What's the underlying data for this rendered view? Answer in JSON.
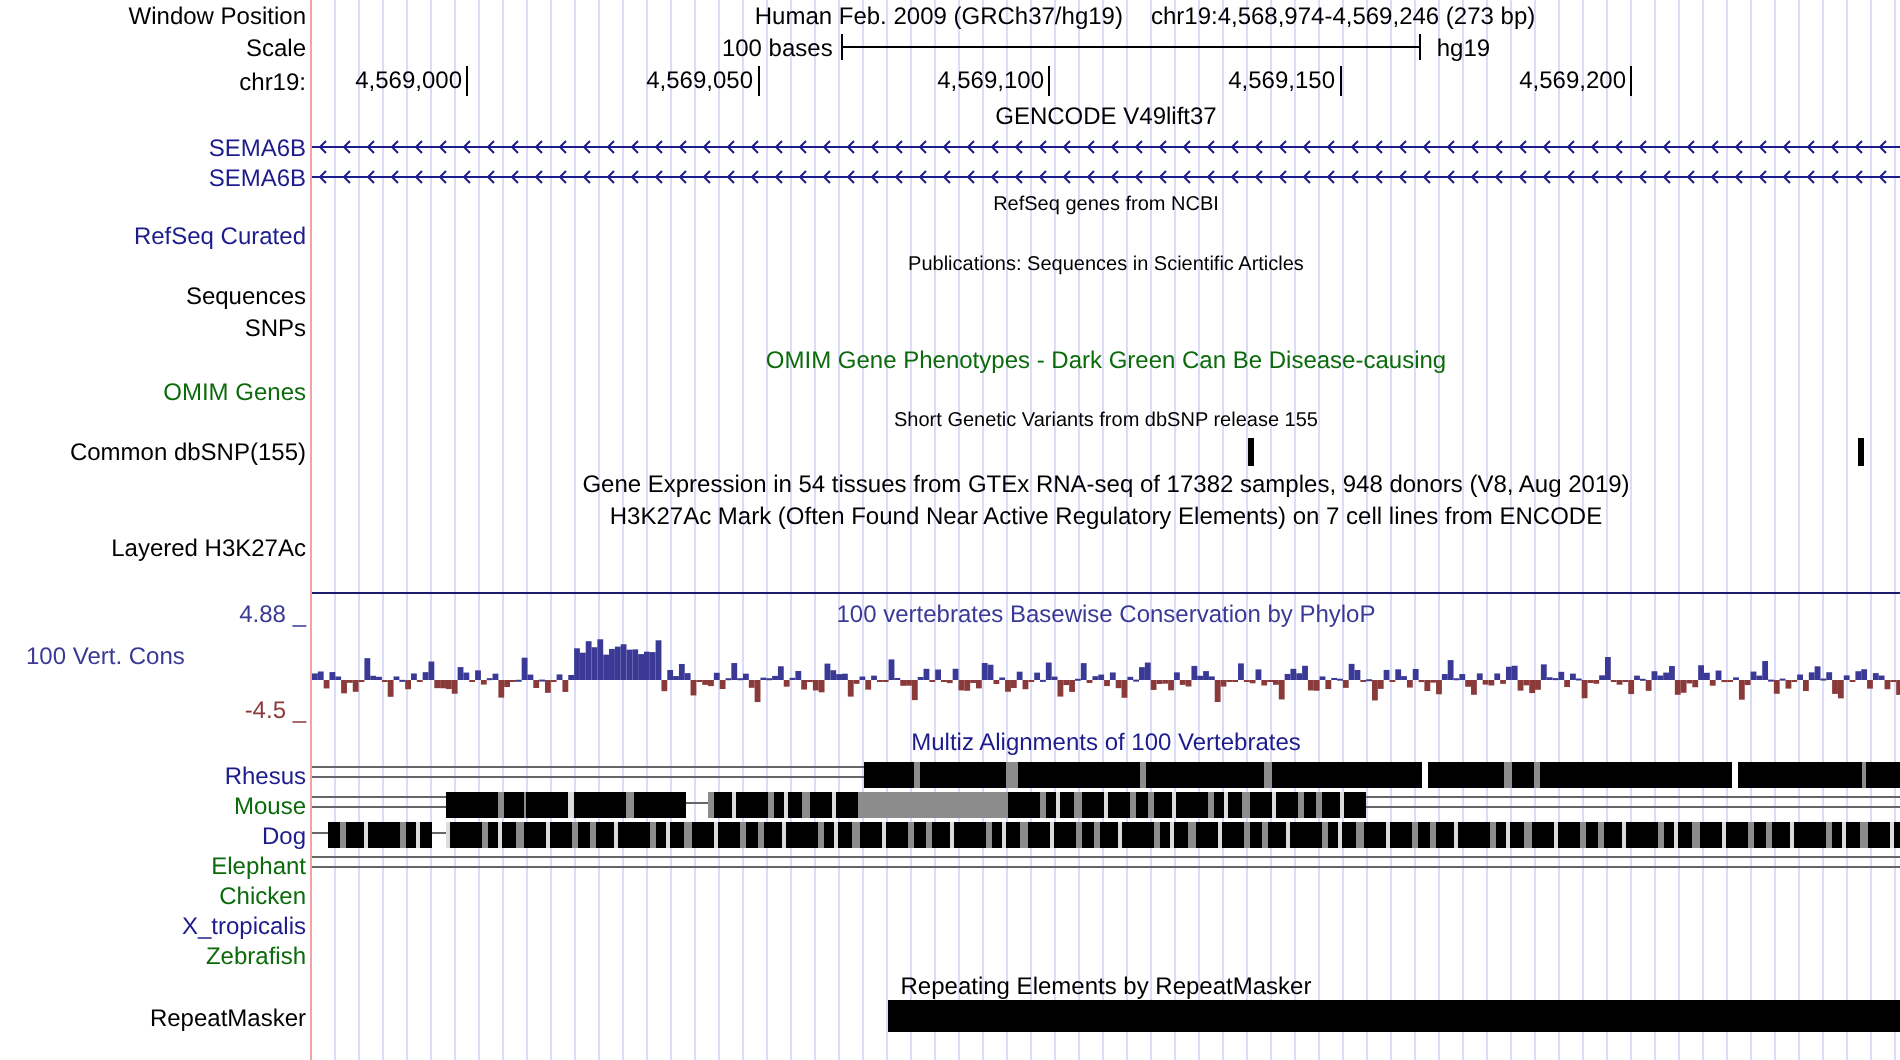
{
  "header": {
    "position_label": "Window Position",
    "assembly": "Human Feb. 2009 (GRCh37/hg19)",
    "position": "chr19:4,568,974-4,569,246 (273 bp)",
    "scale_label": "Scale",
    "scale_length": "100 bases",
    "scale_db": "hg19",
    "chrom_label": "chr19:",
    "ticks": [
      "4,569,000",
      "4,569,050",
      "4,569,100",
      "4,569,150",
      "4,569,200"
    ]
  },
  "tracks": [
    {
      "kind": "title",
      "text": "GENCODE V49lift37",
      "color": "#000000"
    },
    {
      "kind": "gene",
      "label": "SEMA6B",
      "color": "#1c1c8c"
    },
    {
      "kind": "gene",
      "label": "SEMA6B",
      "color": "#1c1c8c"
    },
    {
      "kind": "note",
      "text": "RefSeq genes from NCBI"
    },
    {
      "kind": "label",
      "label": "RefSeq Curated",
      "color": "#1c1c8c"
    },
    {
      "kind": "note",
      "text": "Publications: Sequences in Scientific Articles"
    },
    {
      "kind": "label",
      "label": "Sequences",
      "color": "#000000"
    },
    {
      "kind": "label",
      "label": "SNPs",
      "color": "#000000"
    },
    {
      "kind": "title",
      "text": "OMIM Gene Phenotypes - Dark Green Can Be Disease-causing",
      "color": "#0b6b0b"
    },
    {
      "kind": "label",
      "label": "OMIM Genes",
      "color": "#0b6b0b"
    },
    {
      "kind": "note",
      "text": "Short Genetic Variants from dbSNP release 155"
    },
    {
      "kind": "snp",
      "label": "Common dbSNP(155)"
    },
    {
      "kind": "title",
      "text": "Gene Expression in 54 tissues from GTEx RNA-seq of 17382 samples, 948 donors (V8, Aug 2019)",
      "color": "#000000"
    },
    {
      "kind": "title",
      "text": "H3K27Ac Mark (Often Found Near Active Regulatory Elements) on 7 cell lines from ENCODE",
      "color": "#000000"
    },
    {
      "kind": "label",
      "label": "Layered H3K27Ac",
      "color": "#000000"
    },
    {
      "kind": "conservation",
      "title": "100 vertebrates Basewise Conservation by PhyloP",
      "label": "100 Vert. Cons",
      "max": "4.88 _",
      "min": "-4.5 _"
    },
    {
      "kind": "multiz",
      "title": "Multiz Alignments of 100 Vertebrates",
      "species": [
        {
          "name": "Rhesus",
          "color": "#1c1c8c"
        },
        {
          "name": "Mouse",
          "color": "#0b6b0b"
        },
        {
          "name": "Dog",
          "color": "#1c1c8c"
        },
        {
          "name": "Elephant",
          "color": "#0b6b0b"
        },
        {
          "name": "Chicken",
          "color": "#0b6b0b"
        },
        {
          "name": "X_tropicalis",
          "color": "#1c1c8c"
        },
        {
          "name": "Zebrafish",
          "color": "#0b6b0b"
        }
      ]
    },
    {
      "kind": "repeat",
      "title": "Repeating Elements by RepeatMasker",
      "label": "RepeatMasker"
    }
  ]
}
